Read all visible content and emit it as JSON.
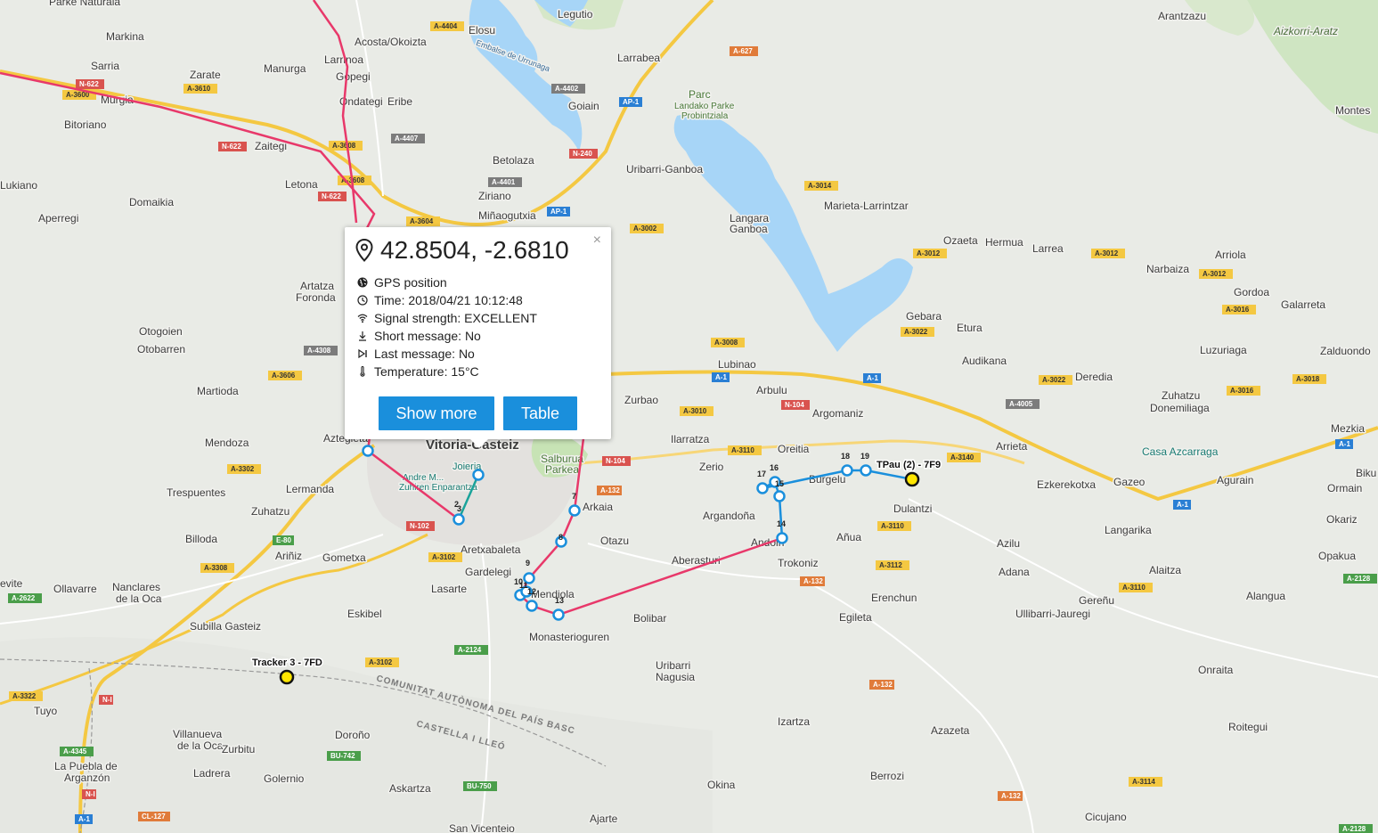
{
  "map": {
    "places": [
      {
        "name": "Parke Naturala"
      },
      {
        "name": "Markina"
      },
      {
        "name": "Sarria"
      },
      {
        "name": "Murgia"
      },
      {
        "name": "Zarate"
      },
      {
        "name": "Manurga"
      },
      {
        "name": "Acosta/Okoizta"
      },
      {
        "name": "Larrinoa"
      },
      {
        "name": "Gopegi"
      },
      {
        "name": "Elosu"
      },
      {
        "name": "Legutio"
      },
      {
        "name": "Larrabea"
      },
      {
        "name": "Goiain"
      },
      {
        "name": "Arantzazu"
      },
      {
        "name": "Aizkorri-Aratz"
      },
      {
        "name": "Montes"
      },
      {
        "name": "Bitoriano"
      },
      {
        "name": "Ondategi"
      },
      {
        "name": "Eribe"
      },
      {
        "name": "Zaitegi"
      },
      {
        "name": "Parc"
      },
      {
        "name": "Landako Parke"
      },
      {
        "name": "Probintziala"
      },
      {
        "name": "Betolaza"
      },
      {
        "name": "Uribarri-Ganboa"
      },
      {
        "name": "Lukiano"
      },
      {
        "name": "Letona"
      },
      {
        "name": "Ziriano"
      },
      {
        "name": "Domaikia"
      },
      {
        "name": "Aperregi"
      },
      {
        "name": "Miñaogutxia"
      },
      {
        "name": "Marieta-Larrintzar"
      },
      {
        "name": "Langara"
      },
      {
        "name": "Ganboa"
      },
      {
        "name": "Ozaeta"
      },
      {
        "name": "Hermua"
      },
      {
        "name": "Larrea"
      },
      {
        "name": "Arriola"
      },
      {
        "name": "Narbaiza"
      },
      {
        "name": "Gordoa"
      },
      {
        "name": "Galarreta"
      },
      {
        "name": "Artatza"
      },
      {
        "name": "Foronda"
      },
      {
        "name": "Gebara"
      },
      {
        "name": "Etura"
      },
      {
        "name": "Luzuriaga"
      },
      {
        "name": "Zalduondo"
      },
      {
        "name": "Otogoien"
      },
      {
        "name": "Otobarren"
      },
      {
        "name": "Lubinao"
      },
      {
        "name": "Audikana"
      },
      {
        "name": "Deredia"
      },
      {
        "name": "Martioda"
      },
      {
        "name": "Arbulu"
      },
      {
        "name": "Zurbao"
      },
      {
        "name": "Argomaniz"
      },
      {
        "name": "Zuhatzu"
      },
      {
        "name": "Donemiliaga"
      },
      {
        "name": "Mezkia"
      },
      {
        "name": "Mendoza"
      },
      {
        "name": "Ilarratza"
      },
      {
        "name": "Oreitia"
      },
      {
        "name": "Arrieta"
      },
      {
        "name": "Casa Azcarraga"
      },
      {
        "name": "Aztegieta"
      },
      {
        "name": "Vitoria-Gasteiz"
      },
      {
        "name": "Salburua"
      },
      {
        "name": "Parkea"
      },
      {
        "name": "Zerio"
      },
      {
        "name": "Burgelu"
      },
      {
        "name": "Ezkerekotxa"
      },
      {
        "name": "Gazeo"
      },
      {
        "name": "Agurain"
      },
      {
        "name": "Biku"
      },
      {
        "name": "Trespuentes"
      },
      {
        "name": "Joieria"
      },
      {
        "name": "Andre M..."
      },
      {
        "name": "Zuhiren Enparantza"
      },
      {
        "name": "Lermanda"
      },
      {
        "name": "Arkaia"
      },
      {
        "name": "Argandoña"
      },
      {
        "name": "Dulantzi"
      },
      {
        "name": "Ormain"
      },
      {
        "name": "Zuhatzu"
      },
      {
        "name": "Langarika"
      },
      {
        "name": "Okariz"
      },
      {
        "name": "Billoda"
      },
      {
        "name": "Otazu"
      },
      {
        "name": "Andoin"
      },
      {
        "name": "Añua"
      },
      {
        "name": "Azilu"
      },
      {
        "name": "Ariñiz"
      },
      {
        "name": "Gometxa"
      },
      {
        "name": "Aretxabaleta"
      },
      {
        "name": "Gardelegi"
      },
      {
        "name": "Aberasturi"
      },
      {
        "name": "Trokoniz"
      },
      {
        "name": "Opakua"
      },
      {
        "name": "Adana"
      },
      {
        "name": "Alaitza"
      },
      {
        "name": "Lasarte"
      },
      {
        "name": "Mendiola"
      },
      {
        "name": "Erenchun"
      },
      {
        "name": "Gereñu"
      },
      {
        "name": "Alangua"
      },
      {
        "name": "evite"
      },
      {
        "name": "Ollavarre"
      },
      {
        "name": "Nanclares"
      },
      {
        "name": "de la Oca"
      },
      {
        "name": "Eskibel"
      },
      {
        "name": "Bolibar"
      },
      {
        "name": "Egileta"
      },
      {
        "name": "Ullibarri-Jauregi"
      },
      {
        "name": "Subilla Gasteiz"
      },
      {
        "name": "Monasterioguren"
      },
      {
        "name": "Uribarri"
      },
      {
        "name": "Nagusia"
      },
      {
        "name": "Onraita"
      },
      {
        "name": "Tuyo"
      },
      {
        "name": "Izartza"
      },
      {
        "name": "Villanueva"
      },
      {
        "name": "de la Oca"
      },
      {
        "name": "Zurbitu"
      },
      {
        "name": "Doroño"
      },
      {
        "name": "Azazeta"
      },
      {
        "name": "Roitegui"
      },
      {
        "name": "La Puebla de"
      },
      {
        "name": "Arganzón"
      },
      {
        "name": "Ladrera"
      },
      {
        "name": "Golernio"
      },
      {
        "name": "Berrozi"
      },
      {
        "name": "Okina"
      },
      {
        "name": "Askartza"
      },
      {
        "name": "Ajarte"
      },
      {
        "name": "Cicujano"
      },
      {
        "name": "San Vicenteio"
      }
    ],
    "roads": [
      {
        "label": "A-4404"
      },
      {
        "label": "A-627"
      },
      {
        "label": "N-622"
      },
      {
        "label": "A-3600"
      },
      {
        "label": "A-3610"
      },
      {
        "label": "A-4402"
      },
      {
        "label": "AP-1"
      },
      {
        "label": "A-4407"
      },
      {
        "label": "N-622"
      },
      {
        "label": "A-3608"
      },
      {
        "label": "N-240"
      },
      {
        "label": "A-4401"
      },
      {
        "label": "A-3608"
      },
      {
        "label": "N-622"
      },
      {
        "label": "A-3014"
      },
      {
        "label": "AP-1"
      },
      {
        "label": "A-3604"
      },
      {
        "label": "A-3002"
      },
      {
        "label": "A-3012"
      },
      {
        "label": "A-3012"
      },
      {
        "label": "A-3012"
      },
      {
        "label": "A-3016"
      },
      {
        "label": "A-3022"
      },
      {
        "label": "A-4308"
      },
      {
        "label": "A-3008"
      },
      {
        "label": "A-3606"
      },
      {
        "label": "A-1"
      },
      {
        "label": "A-1"
      },
      {
        "label": "A-3022"
      },
      {
        "label": "A-3018"
      },
      {
        "label": "A-3016"
      },
      {
        "label": "N-104"
      },
      {
        "label": "A-4005"
      },
      {
        "label": "A-3010"
      },
      {
        "label": "A-1"
      },
      {
        "label": "A-3110"
      },
      {
        "label": "A-3140"
      },
      {
        "label": "A-3302"
      },
      {
        "label": "N-104"
      },
      {
        "label": "A-132"
      },
      {
        "label": "A-1"
      },
      {
        "label": "N-102"
      },
      {
        "label": "A-3110"
      },
      {
        "label": "E-80"
      },
      {
        "label": "A-3102"
      },
      {
        "label": "A-3308"
      },
      {
        "label": "A-3112"
      },
      {
        "label": "A-132"
      },
      {
        "label": "A-3110"
      },
      {
        "label": "A-2128"
      },
      {
        "label": "A-2622"
      },
      {
        "label": "A-3102"
      },
      {
        "label": "A-2124"
      },
      {
        "label": "A-132"
      },
      {
        "label": "A-3322"
      },
      {
        "label": "N-I"
      },
      {
        "label": "A-4345"
      },
      {
        "label": "BU-742"
      },
      {
        "label": "N-I"
      },
      {
        "label": "BU-750"
      },
      {
        "label": "A-3114"
      },
      {
        "label": "A-1"
      },
      {
        "label": "CL-127"
      },
      {
        "label": "A-132"
      },
      {
        "label": "A-2128"
      }
    ],
    "border_labels": [
      {
        "text": "COMUNITAT AUTÒNOMA DEL PAÍS BASC"
      },
      {
        "text": "CASTELLA I LLEÓ"
      }
    ],
    "embalse_label": "Embalse de Urrunaga",
    "route_points": [
      {
        "label": "2"
      },
      {
        "label": "3"
      },
      {
        "label": "7"
      },
      {
        "label": "8"
      },
      {
        "label": "9"
      },
      {
        "label": "10"
      },
      {
        "label": "11"
      },
      {
        "label": "12"
      },
      {
        "label": "13"
      },
      {
        "label": "14"
      },
      {
        "label": "15"
      },
      {
        "label": "16"
      },
      {
        "label": "17"
      },
      {
        "label": "18"
      },
      {
        "label": "19"
      }
    ],
    "trackers": [
      {
        "label": "TPau (2) - 7F9"
      },
      {
        "label": "Tracker 3 - 7FD"
      }
    ],
    "colors": {
      "route_red": "#e8386a",
      "route_blue": "#1a8fdc",
      "route_teal": "#1aa39a",
      "tracker_fill": "#ffe600",
      "water": "#a7d5f7",
      "park": "#cfe8c0",
      "highway": "#f4c842",
      "button": "#1a8fdc"
    }
  },
  "popup": {
    "title_icon": "map-pin-icon",
    "coordinates": "42.8504, -2.6810",
    "close_label": "×",
    "rows": [
      {
        "icon": "globe-icon",
        "text": "GPS position"
      },
      {
        "icon": "clock-icon",
        "text": "Time: 2018/04/21 10:12:48"
      },
      {
        "icon": "wifi-icon",
        "text": "Signal strength: EXCELLENT"
      },
      {
        "icon": "download-icon",
        "text": "Short message: No"
      },
      {
        "icon": "skip-end-icon",
        "text": "Last message: No"
      },
      {
        "icon": "thermometer-icon",
        "text": "Temperature: 15°C"
      }
    ],
    "buttons": {
      "show_more": "Show more",
      "table": "Table"
    }
  }
}
